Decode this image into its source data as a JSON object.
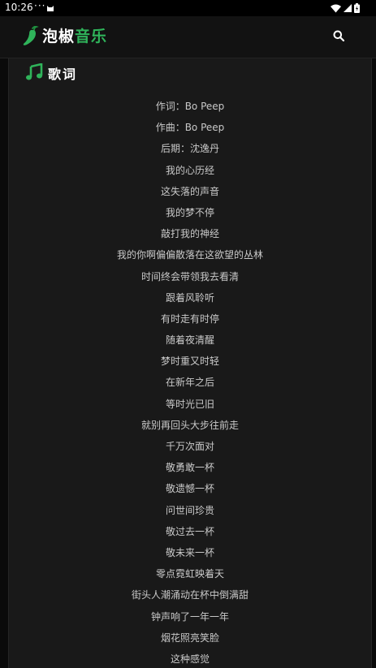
{
  "status_bar": {
    "time": "10:26",
    "dots": "···"
  },
  "app_bar": {
    "logo_part1": "泡椒",
    "logo_part2": "音乐",
    "brand_color": "#2fb35a",
    "search_icon": "search-icon"
  },
  "section": {
    "title": "歌词",
    "icon": "music-note-icon"
  },
  "lyrics": [
    "作词：Bo Peep",
    "作曲：Bo Peep",
    "后期：沈逸丹",
    "我的心历经",
    "这失落的声音",
    "我的梦不停",
    "敲打我的神经",
    "我的你啊偏偏散落在这欲望的丛林",
    "时间终会带领我去看清",
    "跟着风聆听",
    "有时走有时停",
    "随着夜清醒",
    "梦时重又时轻",
    "在新年之后",
    "等时光已旧",
    "就别再回头大步往前走",
    "千万次面对",
    "敬勇敢一杯",
    "敬遗憾一杯",
    "问世间珍贵",
    "敬过去一杯",
    "敬未来一杯",
    "零点霓虹映着天",
    "街头人潮涌动在杯中倒满甜",
    "钟声响了一年一年",
    "烟花照亮笑脸",
    "这种感觉"
  ]
}
